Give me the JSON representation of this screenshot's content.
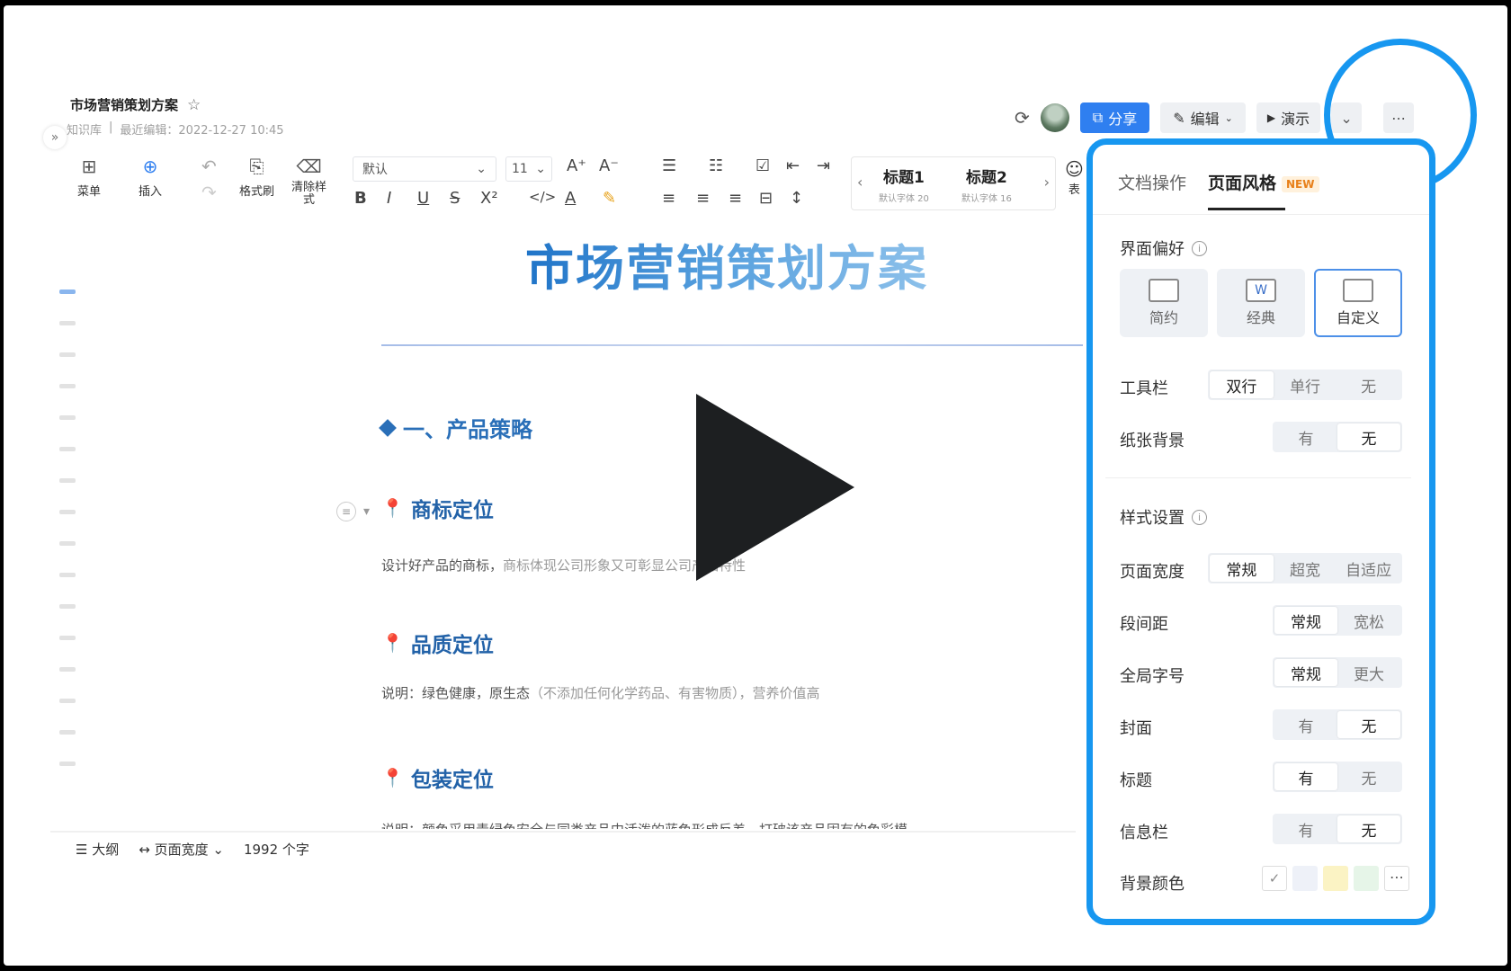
{
  "doc": {
    "title": "市场营销策划方案",
    "star": "☆",
    "meta_location": "知识库",
    "meta_sep": "|",
    "meta_edit": "最近编辑：2022-12-27 10:45"
  },
  "header": {
    "share": "分享",
    "edit": "编辑",
    "present": "演示"
  },
  "toolbar": {
    "menu": "菜单",
    "insert": "插入",
    "format_painter": "格式刷",
    "clear_line1": "清除样",
    "clear_line2": "式",
    "font": "默认",
    "size": "11",
    "heading1": "标题1",
    "heading1_sub": "默认字体 20",
    "heading2": "标题2",
    "heading2_sub": "默认字体 16",
    "more": "表"
  },
  "content": {
    "title": "市场营销策划方案",
    "section1": "一、产品策略",
    "h_brand": "商标定位",
    "p_brand_a": "设计好产品的商标，",
    "p_brand_b": "商标体现公司形象又可彰显公司产品特性",
    "h_quality": "品质定位",
    "p_quality_a": "说明：绿色健康，原生态",
    "p_quality_b": "（不添加任何化学药品、有害物质），营养价值高",
    "h_package": "包装定位",
    "p_package": "说明：颜色采用青绿色安全与同类产品中活泼的蓝色形成反差，打破该产品固有的色彩模"
  },
  "status": {
    "outline": "大纲",
    "page_width": "页面宽度",
    "word_count": "1992 个字"
  },
  "panel": {
    "tab_doc": "文档操作",
    "tab_style": "页面风格",
    "new": "NEW",
    "pref_title": "界面偏好",
    "pref_simple": "简约",
    "pref_classic": "经典",
    "pref_custom": "自定义",
    "toolbar_label": "工具栏",
    "toolbar_opts": [
      "双行",
      "单行",
      "无"
    ],
    "paper_label": "纸张背景",
    "paper_opts": [
      "有",
      "无"
    ],
    "style_title": "样式设置",
    "width_label": "页面宽度",
    "width_opts": [
      "常规",
      "超宽",
      "自适应"
    ],
    "spacing_label": "段间距",
    "spacing_opts": [
      "常规",
      "宽松"
    ],
    "fontsize_label": "全局字号",
    "fontsize_opts": [
      "常规",
      "更大"
    ],
    "cover_label": "封面",
    "cover_opts": [
      "有",
      "无"
    ],
    "title_label": "标题",
    "title_opts": [
      "有",
      "无"
    ],
    "info_label": "信息栏",
    "info_opts": [
      "有",
      "无"
    ],
    "bg_label": "背景颜色"
  },
  "colors": {
    "accent": "#1797f0",
    "brand_blue": "#2f7ff0",
    "title_blue": "#2a6fb8",
    "pin_red": "#d7302a"
  }
}
